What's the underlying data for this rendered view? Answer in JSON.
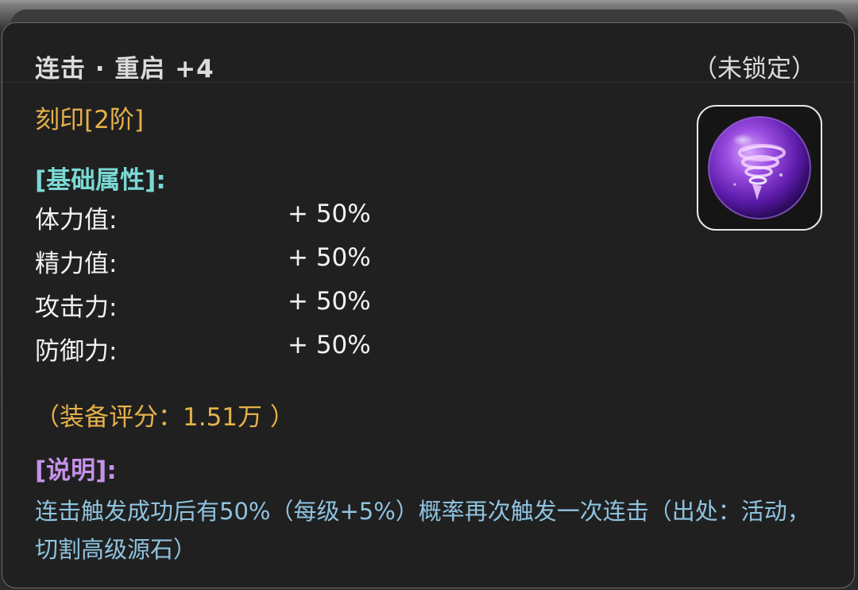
{
  "item": {
    "title": "连击 · 重启  +4",
    "lock_status": "（未锁定）",
    "rank": "刻印[2阶]",
    "icon": "purple-tornado-orb-icon"
  },
  "base_attributes": {
    "heading": "[基础属性]:",
    "rows": [
      {
        "name": "体力值:",
        "value": "+ 50%"
      },
      {
        "name": "精力值:",
        "value": "+ 50%"
      },
      {
        "name": "攻击力:",
        "value": "+ 50%"
      },
      {
        "name": "防御力:",
        "value": "+ 50%"
      }
    ]
  },
  "score": "（装备评分：1.51万 ）",
  "description": {
    "heading": "[说明]:",
    "text": "连击触发成功后有50%（每级+5%）概率再次触发一次连击（出处：活动，切割高级源石）"
  },
  "colors": {
    "panel_bg": "#202020",
    "title": "#dcdcdc",
    "gold": "#e6b14a",
    "cyan_heading": "#7ad9d4",
    "purple_heading": "#c592e8",
    "desc_text": "#8fc3df"
  }
}
